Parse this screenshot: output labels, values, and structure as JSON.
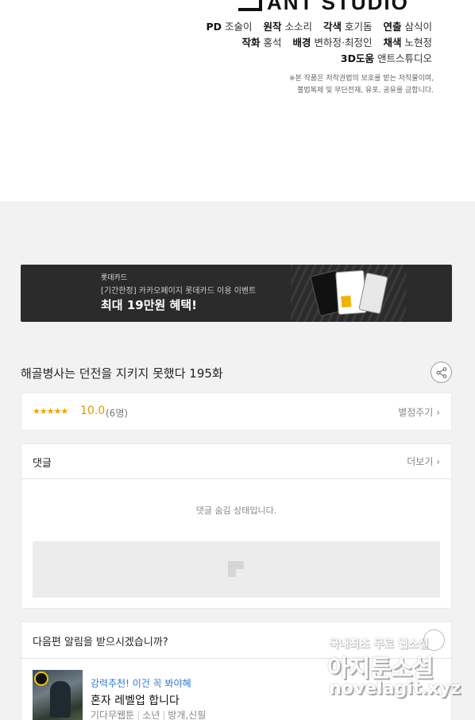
{
  "credits": {
    "studio": "ANT STUDIO",
    "lines": [
      [
        {
          "role": "PD",
          "name": "조술이"
        },
        {
          "role": "원작",
          "name": "소소리"
        },
        {
          "role": "각색",
          "name": "호기돔"
        },
        {
          "role": "연출",
          "name": "삼식이"
        }
      ],
      [
        {
          "role": "작화",
          "name": "홍석"
        },
        {
          "role": "배경",
          "name": "변하정·최정인"
        },
        {
          "role": "채색",
          "name": "노현정"
        }
      ],
      [
        {
          "role": "3D도움",
          "name": "앤트스튜디오"
        }
      ]
    ],
    "notice_1": "※본 작품은 저작권법의 보호를 받는 저작물이며,",
    "notice_2": "불법복제 및 무단전재, 유포, 공유를 금합니다."
  },
  "banner": {
    "brand": "롯데카드",
    "subtitle": "[기간한정] 카카오페이지 롯데카드 이용 이벤트",
    "headline": "최대 19만원 혜택!"
  },
  "episode": {
    "title": "해골병사는 던전을 지키지 못했다 195화"
  },
  "rating": {
    "stars": "★★★★★",
    "score": "10.0",
    "count": "(6명)",
    "rate_label": "별점주기"
  },
  "comments": {
    "label": "댓글",
    "more_label": "더보기",
    "hidden_message": "댓글 숨김 상태입니다."
  },
  "next_episode": {
    "question": "다음편 알림을 받으시겠습니까?",
    "recommendation": {
      "tag": "강력추천! 이건 꼭 봐야혜",
      "title": "혼자 레벨업 합니다",
      "meta": [
        "기다무웹툰",
        "소년",
        "방개,신필"
      ]
    }
  },
  "watermark": {
    "line1": "국내최초 무료 웹소설",
    "line2": "아지툰소설",
    "line3": "novelagit.xyz"
  },
  "colors": {
    "star": "#f0a500",
    "recommend_tag": "#2a7ad9"
  }
}
